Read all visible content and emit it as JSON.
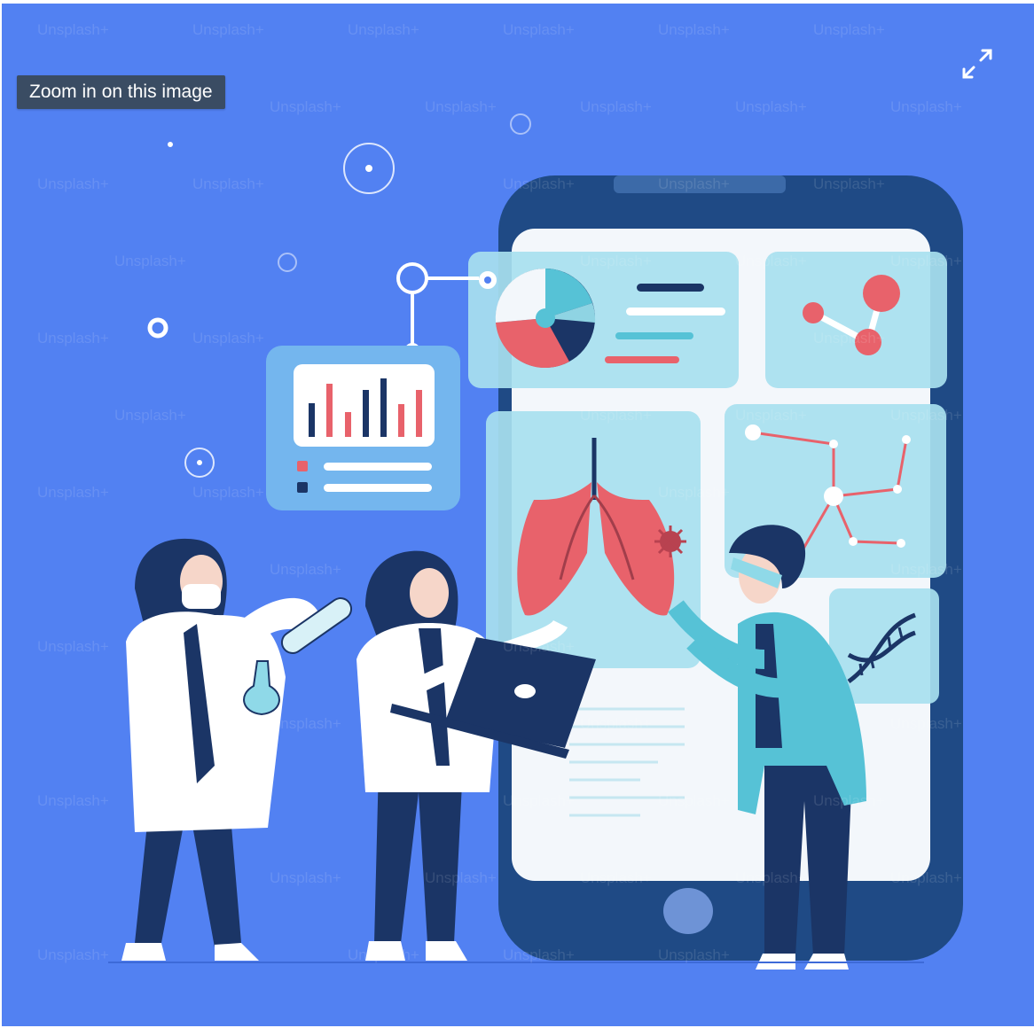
{
  "tooltip": {
    "zoom_text": "Zoom in on this image"
  },
  "controls": {
    "expand_icon": "expand-arrows-icon"
  },
  "watermark": {
    "text": "Unsplash+"
  },
  "colors": {
    "background": "#5281f2",
    "tooltip_bg": "#3a4c63",
    "phone_body": "#1f4a85",
    "phone_screen": "#f3f7fb",
    "panel": "#a8e0ef",
    "accent_red": "#e8626b",
    "navy": "#1b3566",
    "teal": "#56c2d6"
  }
}
